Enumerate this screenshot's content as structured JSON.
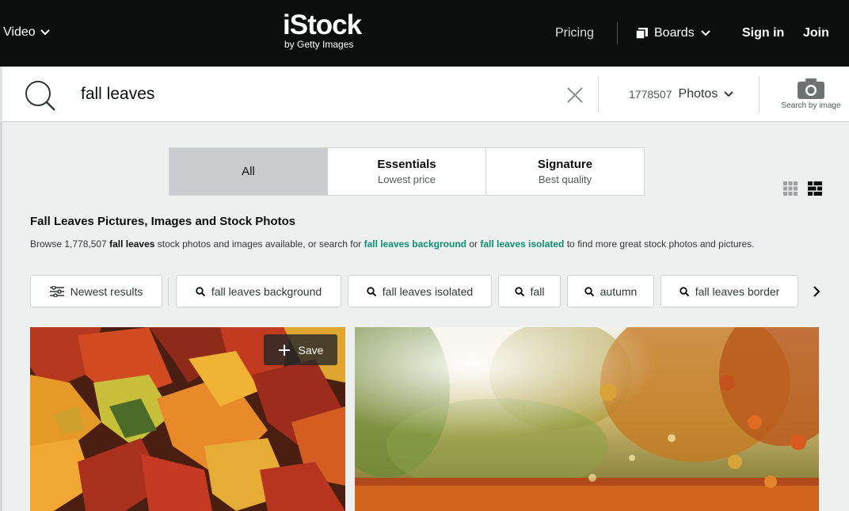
{
  "nav": {
    "video": "Video",
    "logo_main": "iStock",
    "logo_sub": "by Getty Images",
    "pricing": "Pricing",
    "boards": "Boards",
    "sign_in": "Sign in",
    "join": "Join"
  },
  "search": {
    "query": "fall leaves",
    "count": "1778507",
    "media_type": "Photos",
    "search_by_image": "Search by image"
  },
  "tabs": [
    {
      "title": "All",
      "subtitle": ""
    },
    {
      "title": "Essentials",
      "subtitle": "Lowest price"
    },
    {
      "title": "Signature",
      "subtitle": "Best quality"
    }
  ],
  "heading": {
    "title": "Fall Leaves Pictures, Images and Stock Photos",
    "browse_prefix": "Browse 1,778,507 ",
    "browse_term": "fall leaves",
    "browse_mid1": " stock photos and images available, or search for ",
    "link1": "fall leaves background",
    "browse_mid2": " or ",
    "link2": "fall leaves isolated",
    "browse_suffix": " to find more great stock photos and pictures."
  },
  "chips": {
    "sort": "Newest results",
    "items": [
      "fall leaves background",
      "fall leaves isolated",
      "fall",
      "autumn",
      "fall leaves border"
    ]
  },
  "results": {
    "save_label": "Save"
  },
  "colors": {
    "nav_bg": "#0c0d0d",
    "link": "#0a8f71",
    "active_tab": "#c9cdcf"
  }
}
